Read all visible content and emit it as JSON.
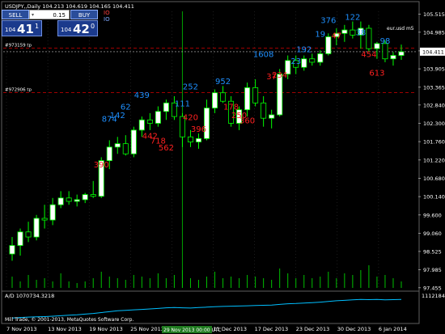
{
  "window": {
    "symbol_info": "USDJPY,,Daily  104.213 104.619 104.165 104.411",
    "corner_label": "eur.usd m5"
  },
  "trade_panel": {
    "sell_label": "SELL",
    "buy_label": "BUY",
    "lot_value": "0.15",
    "sell_price_small": "104",
    "sell_price_big": "41",
    "sell_price_sup": "1",
    "buy_price_small": "104",
    "buy_price_big": "42",
    "buy_price_sup": "0",
    "indicator_lines": [
      "IO",
      "IO"
    ]
  },
  "orders": [
    {
      "label": "#973159 tp",
      "price": 104.52
    },
    {
      "label": "#972906 tp",
      "price": 103.2
    }
  ],
  "current_price": "104.411",
  "indicator": {
    "label": "A/D 1070734.3218",
    "scale_label": "1112184"
  },
  "footer_credit": "Mill Trade, © 2001-2013, MetaQuotes Software Corp.",
  "colors": {
    "background": "#000000",
    "bull_candle": "#ffffff",
    "bear_candle": "#000000",
    "wick": "#00ff00",
    "grid": "#303030",
    "blue_label": "#1e90ff",
    "red_label": "#ff2020",
    "order_line": "#ff0000",
    "price_line": "#ffffff",
    "volume": "#00c000",
    "indicator_line": "#00bfff"
  },
  "chart_data": {
    "type": "candlestick",
    "y_axis": {
      "min": 97.45,
      "max": 105.6,
      "ticks": [
        "105.515",
        "104.985",
        "104.435",
        "103.905",
        "103.365",
        "102.840",
        "102.300",
        "101.760",
        "101.220",
        "100.680",
        "100.140",
        "99.600",
        "99.060",
        "98.525",
        "97.985",
        "97.455"
      ]
    },
    "x_axis_labels": [
      "7 Nov 2013",
      "13 Nov 2013",
      "19 Nov 2013",
      "25 Nov 2013",
      "29 No",
      "11 Dec 2013",
      "17 Dec 2013",
      "23 Dec 2013",
      "30 Dec 2013",
      "6 Jan 2014"
    ],
    "x_axis_highlight": "29 Nov 2013 00:00 UTC",
    "candles": [
      {
        "o": 98.45,
        "h": 98.95,
        "l": 98.25,
        "c": 98.7
      },
      {
        "o": 98.7,
        "h": 99.2,
        "l": 98.4,
        "c": 99.1
      },
      {
        "o": 99.1,
        "h": 99.4,
        "l": 98.8,
        "c": 98.95
      },
      {
        "o": 98.95,
        "h": 99.6,
        "l": 98.85,
        "c": 99.5
      },
      {
        "o": 99.5,
        "h": 99.9,
        "l": 99.2,
        "c": 99.45
      },
      {
        "o": 99.45,
        "h": 100.1,
        "l": 99.3,
        "c": 99.9
      },
      {
        "o": 99.9,
        "h": 100.3,
        "l": 99.8,
        "c": 100.1
      },
      {
        "o": 100.1,
        "h": 100.3,
        "l": 99.9,
        "c": 100.0
      },
      {
        "o": 100.0,
        "h": 100.2,
        "l": 99.85,
        "c": 100.05
      },
      {
        "o": 100.05,
        "h": 100.25,
        "l": 99.95,
        "c": 100.2
      },
      {
        "o": 100.2,
        "h": 100.6,
        "l": 100.1,
        "c": 100.15
      },
      {
        "o": 100.15,
        "h": 101.3,
        "l": 100.1,
        "c": 101.2
      },
      {
        "o": 101.2,
        "h": 101.8,
        "l": 100.95,
        "c": 101.6
      },
      {
        "o": 101.6,
        "h": 101.9,
        "l": 101.4,
        "c": 101.7
      },
      {
        "o": 101.7,
        "h": 101.95,
        "l": 101.35,
        "c": 101.4
      },
      {
        "o": 101.4,
        "h": 102.2,
        "l": 101.3,
        "c": 102.1
      },
      {
        "o": 102.1,
        "h": 102.5,
        "l": 101.9,
        "c": 102.4
      },
      {
        "o": 102.4,
        "h": 102.6,
        "l": 102.1,
        "c": 102.3
      },
      {
        "o": 102.3,
        "h": 102.8,
        "l": 102.2,
        "c": 102.65
      },
      {
        "o": 102.65,
        "h": 103.0,
        "l": 102.4,
        "c": 102.9
      },
      {
        "o": 102.9,
        "h": 103.1,
        "l": 102.4,
        "c": 102.5
      },
      {
        "o": 102.5,
        "h": 102.6,
        "l": 101.6,
        "c": 101.9
      },
      {
        "o": 101.9,
        "h": 102.1,
        "l": 101.6,
        "c": 101.75
      },
      {
        "o": 101.75,
        "h": 102.0,
        "l": 101.55,
        "c": 101.85
      },
      {
        "o": 101.85,
        "h": 103.0,
        "l": 101.8,
        "c": 102.75
      },
      {
        "o": 102.75,
        "h": 103.3,
        "l": 102.6,
        "c": 103.2
      },
      {
        "o": 103.2,
        "h": 103.4,
        "l": 102.9,
        "c": 102.95
      },
      {
        "o": 102.95,
        "h": 103.1,
        "l": 102.2,
        "c": 102.3
      },
      {
        "o": 102.3,
        "h": 102.8,
        "l": 102.1,
        "c": 102.7
      },
      {
        "o": 102.7,
        "h": 103.5,
        "l": 102.5,
        "c": 103.35
      },
      {
        "o": 103.35,
        "h": 103.6,
        "l": 102.8,
        "c": 102.9
      },
      {
        "o": 102.9,
        "h": 103.1,
        "l": 102.2,
        "c": 102.45
      },
      {
        "o": 102.45,
        "h": 102.7,
        "l": 102.15,
        "c": 102.55
      },
      {
        "o": 102.55,
        "h": 103.9,
        "l": 102.5,
        "c": 103.75
      },
      {
        "o": 103.75,
        "h": 104.3,
        "l": 103.6,
        "c": 104.15
      },
      {
        "o": 104.15,
        "h": 104.3,
        "l": 103.75,
        "c": 103.95
      },
      {
        "o": 103.95,
        "h": 104.3,
        "l": 103.85,
        "c": 104.2
      },
      {
        "o": 104.2,
        "h": 104.35,
        "l": 104.0,
        "c": 104.1
      },
      {
        "o": 104.1,
        "h": 104.45,
        "l": 104.0,
        "c": 104.35
      },
      {
        "o": 104.35,
        "h": 104.95,
        "l": 104.3,
        "c": 104.85
      },
      {
        "o": 104.85,
        "h": 105.1,
        "l": 104.6,
        "c": 104.95
      },
      {
        "o": 104.95,
        "h": 105.2,
        "l": 104.7,
        "c": 105.05
      },
      {
        "o": 105.05,
        "h": 105.3,
        "l": 104.8,
        "c": 104.9
      },
      {
        "o": 104.9,
        "h": 105.3,
        "l": 104.5,
        "c": 105.1
      },
      {
        "o": 105.1,
        "h": 105.2,
        "l": 104.4,
        "c": 104.5
      },
      {
        "o": 104.5,
        "h": 104.7,
        "l": 104.2,
        "c": 104.65
      },
      {
        "o": 104.65,
        "h": 104.75,
        "l": 104.1,
        "c": 104.2
      },
      {
        "o": 104.2,
        "h": 104.4,
        "l": 104.0,
        "c": 104.3
      },
      {
        "o": 104.3,
        "h": 104.62,
        "l": 104.17,
        "c": 104.41
      }
    ],
    "labels": [
      {
        "t": "390",
        "i": 11,
        "p": 101.0,
        "c": "red"
      },
      {
        "t": "874",
        "i": 12,
        "p": 102.35,
        "c": "blue"
      },
      {
        "t": "142",
        "i": 13,
        "p": 102.45,
        "c": "blue"
      },
      {
        "t": "62",
        "i": 14,
        "p": 102.7,
        "c": "blue"
      },
      {
        "t": "439",
        "i": 16,
        "p": 103.05,
        "c": "blue"
      },
      {
        "t": "442",
        "i": 17,
        "p": 101.85,
        "c": "red"
      },
      {
        "t": "718",
        "i": 18,
        "p": 101.7,
        "c": "red"
      },
      {
        "t": "562",
        "i": 19,
        "p": 101.5,
        "c": "red"
      },
      {
        "t": "111",
        "i": 21,
        "p": 102.8,
        "c": "blue"
      },
      {
        "t": "252",
        "i": 22,
        "p": 103.3,
        "c": "blue"
      },
      {
        "t": "420",
        "i": 22,
        "p": 102.4,
        "c": "red"
      },
      {
        "t": "396",
        "i": 23,
        "p": 102.05,
        "c": "red"
      },
      {
        "t": "952",
        "i": 26,
        "p": 103.45,
        "c": "blue"
      },
      {
        "t": "178",
        "i": 27,
        "p": 102.7,
        "c": "red"
      },
      {
        "t": "250",
        "i": 28,
        "p": 102.45,
        "c": "red"
      },
      {
        "t": "360",
        "i": 29,
        "p": 102.3,
        "c": "red"
      },
      {
        "t": "1608",
        "i": 31,
        "p": 104.25,
        "c": "blue"
      },
      {
        "t": "37",
        "i": 32,
        "p": 103.6,
        "c": "red"
      },
      {
        "t": "234",
        "i": 33,
        "p": 103.65,
        "c": "red"
      },
      {
        "t": "23",
        "i": 35,
        "p": 104.05,
        "c": "blue"
      },
      {
        "t": "192",
        "i": 36,
        "p": 104.4,
        "c": "blue"
      },
      {
        "t": "19",
        "i": 38,
        "p": 104.85,
        "c": "blue"
      },
      {
        "t": "376",
        "i": 39,
        "p": 105.25,
        "c": "blue"
      },
      {
        "t": "47",
        "i": 40,
        "p": 104.8,
        "c": "red"
      },
      {
        "t": "122",
        "i": 42,
        "p": 105.35,
        "c": "blue"
      },
      {
        "t": "38",
        "i": 43,
        "p": 104.9,
        "c": "blue"
      },
      {
        "t": "454",
        "i": 44,
        "p": 104.25,
        "c": "red"
      },
      {
        "t": "98",
        "i": 46,
        "p": 104.65,
        "c": "blue"
      },
      {
        "t": "613",
        "i": 45,
        "p": 103.7,
        "c": "red"
      }
    ],
    "volumes": [
      0.35,
      0.2,
      0.4,
      0.25,
      0.3,
      0.2,
      0.45,
      0.2,
      0.15,
      0.2,
      0.3,
      0.5,
      0.35,
      0.3,
      0.25,
      0.4,
      0.35,
      0.3,
      0.45,
      0.3,
      0.4,
      0.55,
      0.3,
      0.25,
      0.35,
      0.5,
      0.3,
      0.35,
      0.3,
      0.4,
      0.35,
      0.3,
      0.25,
      0.6,
      0.45,
      0.3,
      0.4,
      0.3,
      0.35,
      0.5,
      0.3,
      0.45,
      0.4,
      0.55,
      0.7,
      0.35,
      0.4,
      0.3,
      0.2
    ],
    "indicator_values": [
      0.1,
      0.12,
      0.14,
      0.15,
      0.16,
      0.18,
      0.2,
      0.22,
      0.24,
      0.27,
      0.3,
      0.34,
      0.38,
      0.42,
      0.44,
      0.46,
      0.48,
      0.5,
      0.52,
      0.55,
      0.56,
      0.55,
      0.54,
      0.56,
      0.58,
      0.6,
      0.61,
      0.62,
      0.63,
      0.64,
      0.65,
      0.66,
      0.67,
      0.7,
      0.73,
      0.74,
      0.76,
      0.78,
      0.8,
      0.83,
      0.86,
      0.88,
      0.9,
      0.92,
      0.91,
      0.92,
      0.9,
      0.91,
      0.92
    ]
  }
}
